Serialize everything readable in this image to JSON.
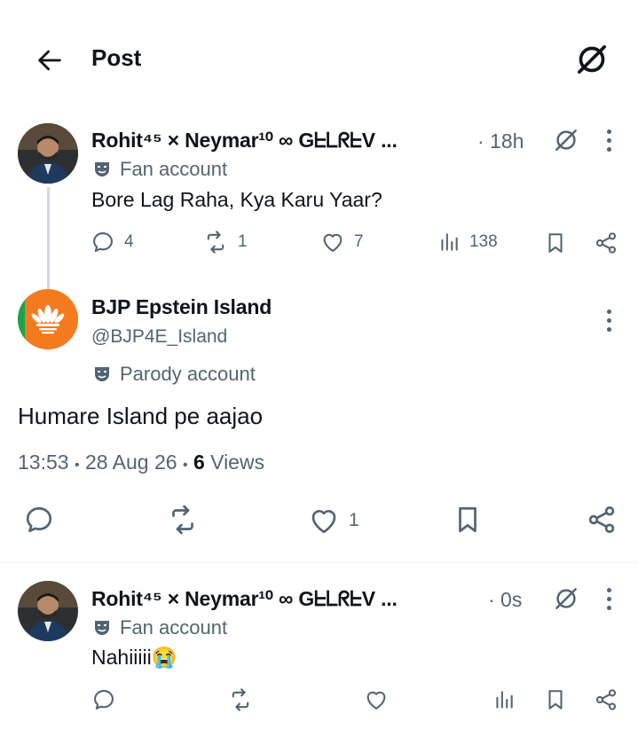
{
  "header": {
    "title": "Post",
    "back_icon": "arrow-left-icon",
    "grok_icon": "grok-icon"
  },
  "parent_post": {
    "author_name": "Rohit⁴⁵ × Neymar¹⁰ ∞ GᖶᒪᖇᖶV ...",
    "time": "· 18h",
    "badge": "Fan account",
    "text": "Bore Lag Raha, Kya Karu Yaar?",
    "replies": "4",
    "reposts": "1",
    "likes": "7",
    "views": "138"
  },
  "main_post": {
    "author_name": "BJP Epstein Island",
    "handle": "@BJP4E_Island",
    "badge": "Parody account",
    "text": "Humare Island pe aajao",
    "time": "13:53",
    "sep1": "•",
    "date": "28 Aug 26",
    "sep2": "•",
    "views_count": "6",
    "views_label": "Views",
    "likes": "1"
  },
  "reply_post": {
    "author_name": "Rohit⁴⁵ × Neymar¹⁰ ∞ GᖶᒪᖇᖶV ...",
    "time": "· 0s",
    "badge": "Fan account",
    "text": "Nahiiiii😭"
  },
  "colors": {
    "text": "#0f1419",
    "secondary": "#536471",
    "divider": "#eff3f4",
    "thread_line": "#cfd9de"
  }
}
